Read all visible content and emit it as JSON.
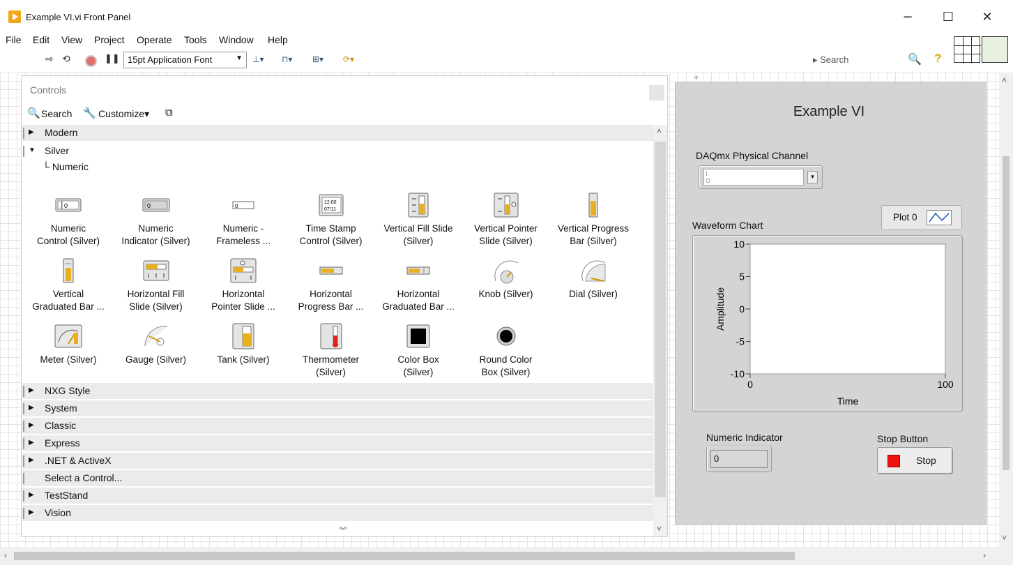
{
  "window": {
    "title": "Example VI.vi Front Panel",
    "minimize_glyph": "−",
    "maximize_glyph": "☐",
    "close_glyph": "✕"
  },
  "menu": [
    "File",
    "Edit",
    "View",
    "Project",
    "Operate",
    "Tools",
    "Window",
    "Help"
  ],
  "toolbar": {
    "font_select": "15pt Application Font",
    "search_placeholder": "Search",
    "icons": [
      "run-arrow-icon",
      "run-continuously-icon",
      "abort-icon",
      "pause-icon",
      "align-objects-icon",
      "distribute-objects-icon",
      "resize-objects-icon",
      "reorder-icon",
      "search-icon",
      "help-icon"
    ]
  },
  "palette": {
    "title": "Controls",
    "search_label": "Search",
    "customize_label": "Customize▾",
    "categories_top": [
      "Modern"
    ],
    "expanded": "Silver",
    "subcategory": "Numeric",
    "items": [
      {
        "line1": "Numeric",
        "line2": "Control (Silver)",
        "icon": "numeric-control-icon"
      },
      {
        "line1": "Numeric",
        "line2": "Indicator (Silver)",
        "icon": "numeric-indicator-icon"
      },
      {
        "line1": "Numeric -",
        "line2": "Frameless ...",
        "icon": "numeric-frameless-icon"
      },
      {
        "line1": "Time Stamp",
        "line2": "Control (Silver)",
        "icon": "time-stamp-icon"
      },
      {
        "line1": "Vertical Fill Slide",
        "line2": "(Silver)",
        "icon": "vertical-fill-slide-icon"
      },
      {
        "line1": "Vertical Pointer",
        "line2": "Slide (Silver)",
        "icon": "vertical-pointer-slide-icon"
      },
      {
        "line1": "Vertical Progress",
        "line2": "Bar (Silver)",
        "icon": "vertical-progress-bar-icon"
      },
      {
        "line1": "Vertical",
        "line2": "Graduated Bar ...",
        "icon": "vertical-graduated-bar-icon"
      },
      {
        "line1": "Horizontal Fill",
        "line2": "Slide (Silver)",
        "icon": "horizontal-fill-slide-icon"
      },
      {
        "line1": "Horizontal",
        "line2": "Pointer Slide ...",
        "icon": "horizontal-pointer-slide-icon"
      },
      {
        "line1": "Horizontal",
        "line2": "Progress Bar ...",
        "icon": "horizontal-progress-bar-icon"
      },
      {
        "line1": "Horizontal",
        "line2": "Graduated Bar ...",
        "icon": "horizontal-graduated-bar-icon"
      },
      {
        "line1": "Knob (Silver)",
        "line2": "",
        "icon": "knob-icon"
      },
      {
        "line1": "Dial (Silver)",
        "line2": "",
        "icon": "dial-icon"
      },
      {
        "line1": "Meter (Silver)",
        "line2": "",
        "icon": "meter-icon"
      },
      {
        "line1": "Gauge (Silver)",
        "line2": "",
        "icon": "gauge-icon"
      },
      {
        "line1": "Tank (Silver)",
        "line2": "",
        "icon": "tank-icon"
      },
      {
        "line1": "Thermometer",
        "line2": "(Silver)",
        "icon": "thermometer-icon"
      },
      {
        "line1": "Color Box",
        "line2": "(Silver)",
        "icon": "color-box-icon"
      },
      {
        "line1": "Round Color",
        "line2": "Box (Silver)",
        "icon": "round-color-box-icon"
      }
    ],
    "icon_text": {
      "num_ctrl": "0",
      "num_ind": "0",
      "num_frameless": "0",
      "time_a": "12:00",
      "time_b": "07/11"
    },
    "categories_bottom": [
      "NXG Style",
      "System",
      "Classic",
      "Express",
      ".NET & ActiveX",
      "Select a Control...",
      "TestStand",
      "Vision"
    ]
  },
  "front_panel": {
    "title": "Example VI",
    "channel_label": "DAQmx Physical Channel",
    "chart_label": "Waveform Chart",
    "plot_name": "Plot 0",
    "numeric_label": "Numeric Indicator",
    "numeric_value": "0",
    "stop_label": "Stop Button",
    "stop_text": "Stop"
  },
  "chart_data": {
    "type": "line",
    "title": "Waveform Chart",
    "xlabel": "Time",
    "ylabel": "Amplitude",
    "xlim": [
      0,
      100
    ],
    "ylim": [
      -10,
      10
    ],
    "x_ticks": [
      "0",
      "100"
    ],
    "y_ticks": [
      "10",
      "5",
      "0",
      "-5",
      "-10"
    ],
    "series": [
      {
        "name": "Plot 0",
        "values": []
      }
    ],
    "grid": false,
    "plot_color": "#ffffff",
    "legend": "top-right"
  }
}
